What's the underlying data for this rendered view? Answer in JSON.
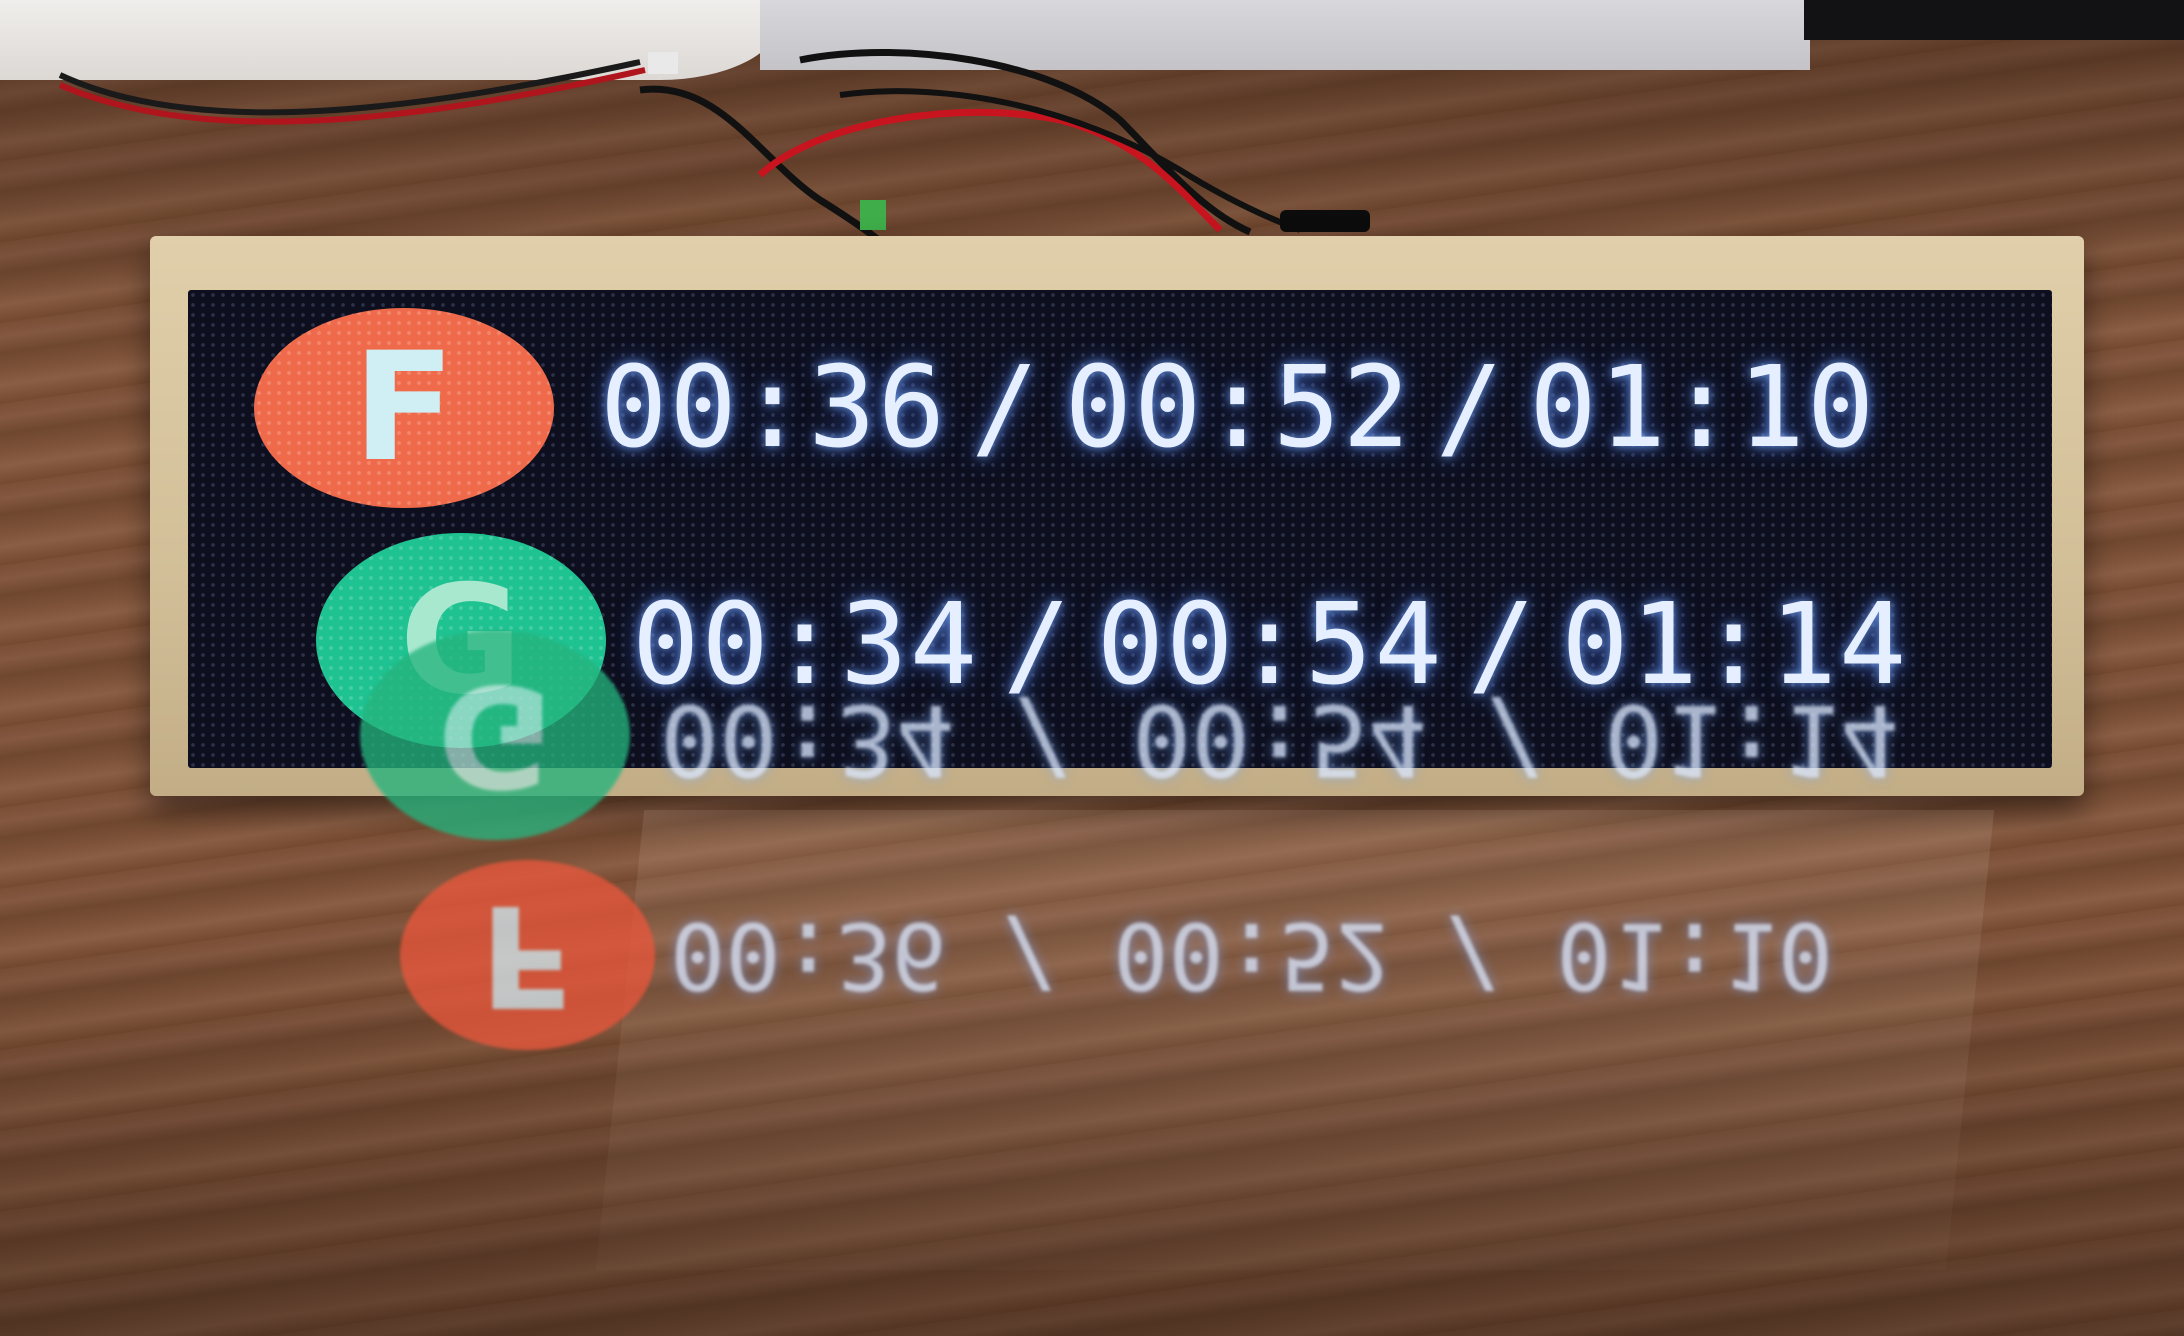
{
  "display": {
    "rows": [
      {
        "route": "F",
        "route_color": "#ef6a4a",
        "times": [
          "00:36",
          "00:52",
          "01:10"
        ],
        "separator": "/"
      },
      {
        "route": "G",
        "route_color": "#1fc291",
        "times": [
          "00:34",
          "00:54",
          "01:14"
        ],
        "separator": "/"
      }
    ],
    "text_color": "#e6efff",
    "glow_color": "#4a78ff"
  },
  "scene": {
    "frame_color": "#d6c39c",
    "panel_color": "#0d0f1e",
    "table_color": "#7a4f35"
  }
}
